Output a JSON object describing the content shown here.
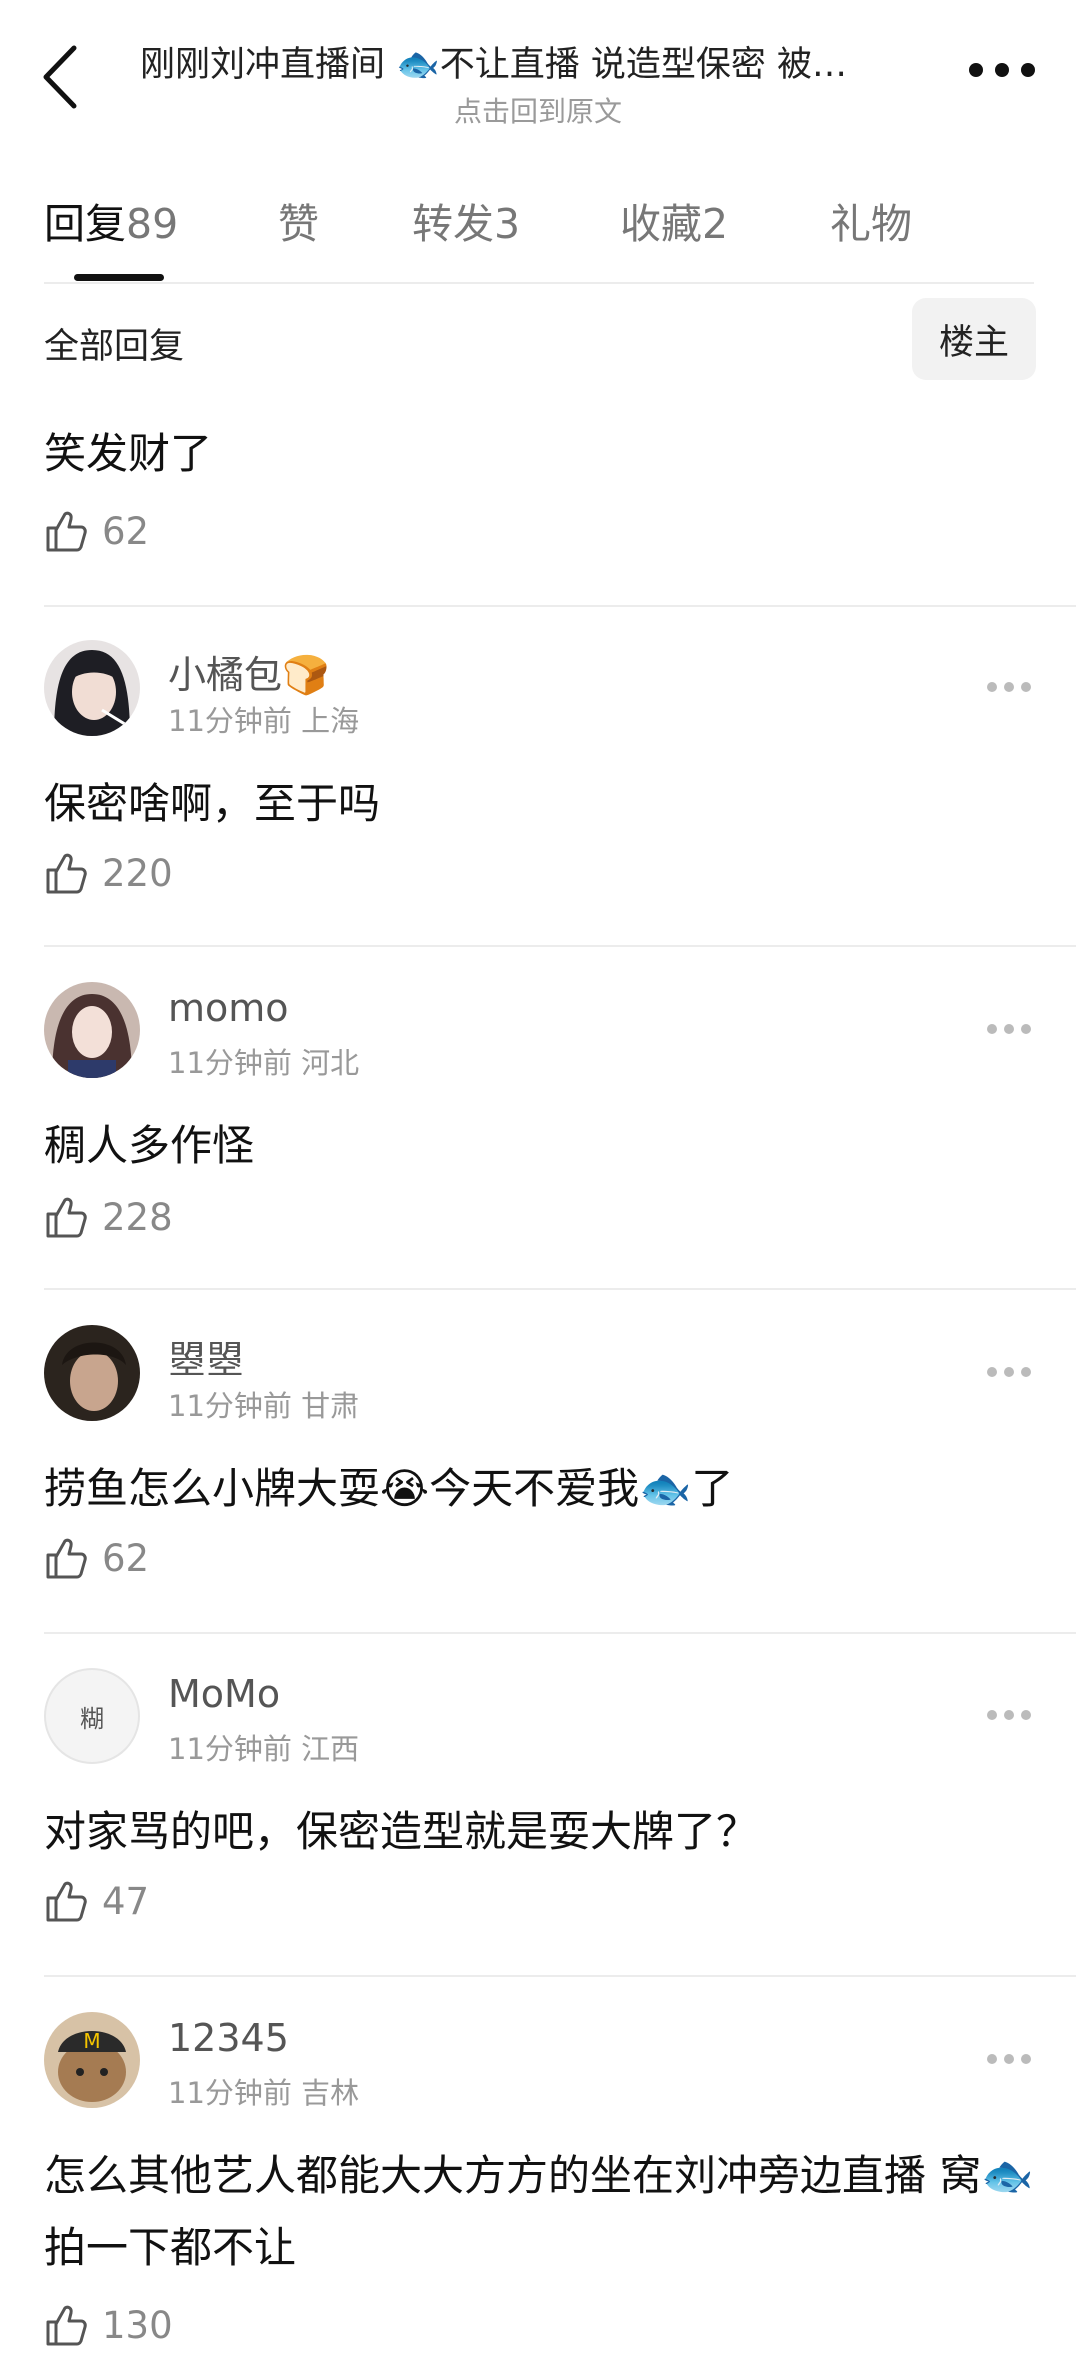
{
  "header": {
    "title": "刚刚刘冲直播间 🐟不让直播 说造型保密 被…",
    "subtitle": "点击回到原文"
  },
  "tabs": [
    {
      "label": "回复",
      "count": "89"
    },
    {
      "label": "赞",
      "count": ""
    },
    {
      "label": "转发",
      "count": "3"
    },
    {
      "label": "收藏",
      "count": "2"
    },
    {
      "label": "礼物",
      "count": ""
    }
  ],
  "filter": {
    "label": "全部回复",
    "button": "楼主"
  },
  "first": {
    "text": "笑发财了",
    "likes": "62"
  },
  "comments": [
    {
      "name": "小橘包🍞",
      "time": "11分钟前",
      "region": "上海",
      "text": "保密啥啊，至于吗",
      "likes": "220",
      "avatar_color": "#3a3a40"
    },
    {
      "name": "momo",
      "time": "11分钟前",
      "region": "河北",
      "text": "稠人多作怪",
      "likes": "228",
      "avatar_color": "#7a5a55"
    },
    {
      "name": "曌曌",
      "time": "11分钟前",
      "region": "甘肃",
      "text": "捞鱼怎么小牌大耍😭今天不爱我🐟了",
      "likes": "62",
      "avatar_color": "#3b3028"
    },
    {
      "name": "MoMo",
      "time": "11分钟前",
      "region": "江西",
      "text": "对家骂的吧，保密造型就是耍大牌了？",
      "likes": "47",
      "avatar_text": "糊",
      "avatar_color": "#f4f4f4"
    },
    {
      "name": "12345",
      "time": "11分钟前",
      "region": "吉林",
      "text": "怎么其他艺人都能大大方方的坐在刘冲旁边直播 窝🐟拍一下都不让",
      "likes": "130",
      "avatar_color": "#8a6a4a"
    }
  ]
}
